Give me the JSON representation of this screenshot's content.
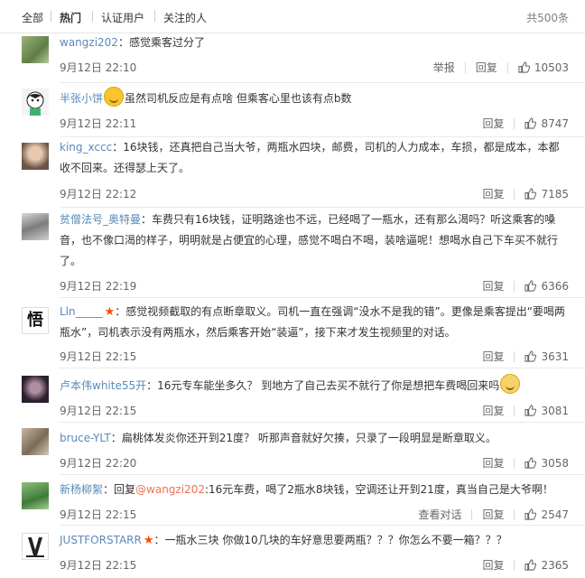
{
  "tabs": {
    "all": "全部",
    "hot": "热门",
    "verified": "认证用户",
    "following": "关注的人"
  },
  "total": "共500条",
  "actions": {
    "report": "举报",
    "reply": "回复",
    "view_dialog": "查看对话"
  },
  "comments": [
    {
      "user": "wangzi202",
      "text": "：感觉乘客过分了",
      "time": "9月12日 22:10",
      "likes": "10503"
    },
    {
      "user": "半张小饼",
      "text": "虽然司机反应是有点啥 但乘客心里也该有点b数",
      "time": "9月12日 22:11",
      "likes": "8747"
    },
    {
      "user": "king_xccc",
      "text": "：16块钱，还真把自己当大爷，两瓶水四块，邮费，司机的人力成本，车损，都是成本，本都收不回来。还得瑟上天了。",
      "time": "9月12日 22:12",
      "likes": "7185"
    },
    {
      "user": "贫僧法号_奥特曼",
      "text": "：车费只有16块钱，证明路途也不远，已经喝了一瓶水，还有那么渴吗？听这乘客的嗓音，也不像口渴的样子，明明就是占便宜的心理，感觉不喝白不喝，装啥逼呢！想喝水自己下车买不就行了。",
      "time": "9月12日 22:19",
      "likes": "6366"
    },
    {
      "user": "Lln_____",
      "text": "：感觉视频截取的有点断章取义。司机一直在强调“没水不是我的错”。更像是乘客提出“要喝两瓶水”，司机表示没有两瓶水，然后乘客开始“装逼”，接下来才发生视频里的对话。",
      "time": "9月12日 22:15",
      "likes": "3631"
    },
    {
      "user": "卢本伟white55开",
      "text": "：16元专车能坐多久？ 到地方了自己去买不就行了你是想把车费喝回来吗",
      "time": "9月12日 22:15",
      "likes": "3081"
    },
    {
      "user": "bruce-YLT",
      "text": "：扁桃体发炎你还开到21度？ 听那声音就好欠揍，只录了一段明显是断章取义。",
      "time": "9月12日 22:20",
      "likes": "3058"
    },
    {
      "user": "新杨柳絮",
      "text": "：回复",
      "mention": "@wangzi202",
      "text2": ":16元车费，喝了2瓶水8块钱，空调还让开到21度，真当自己是大爷啊！",
      "time": "9月12日 22:15",
      "likes": "2547"
    },
    {
      "user": "JUSTFORSTARR",
      "text": "：一瓶水三块 你做10几块的车好意思要两瓶？？？你怎么不要一箱？？？",
      "time": "9月12日 22:15",
      "likes": "2365"
    }
  ],
  "icons": {
    "like": "thumbs-up-icon",
    "verified": "red-star-icon"
  }
}
